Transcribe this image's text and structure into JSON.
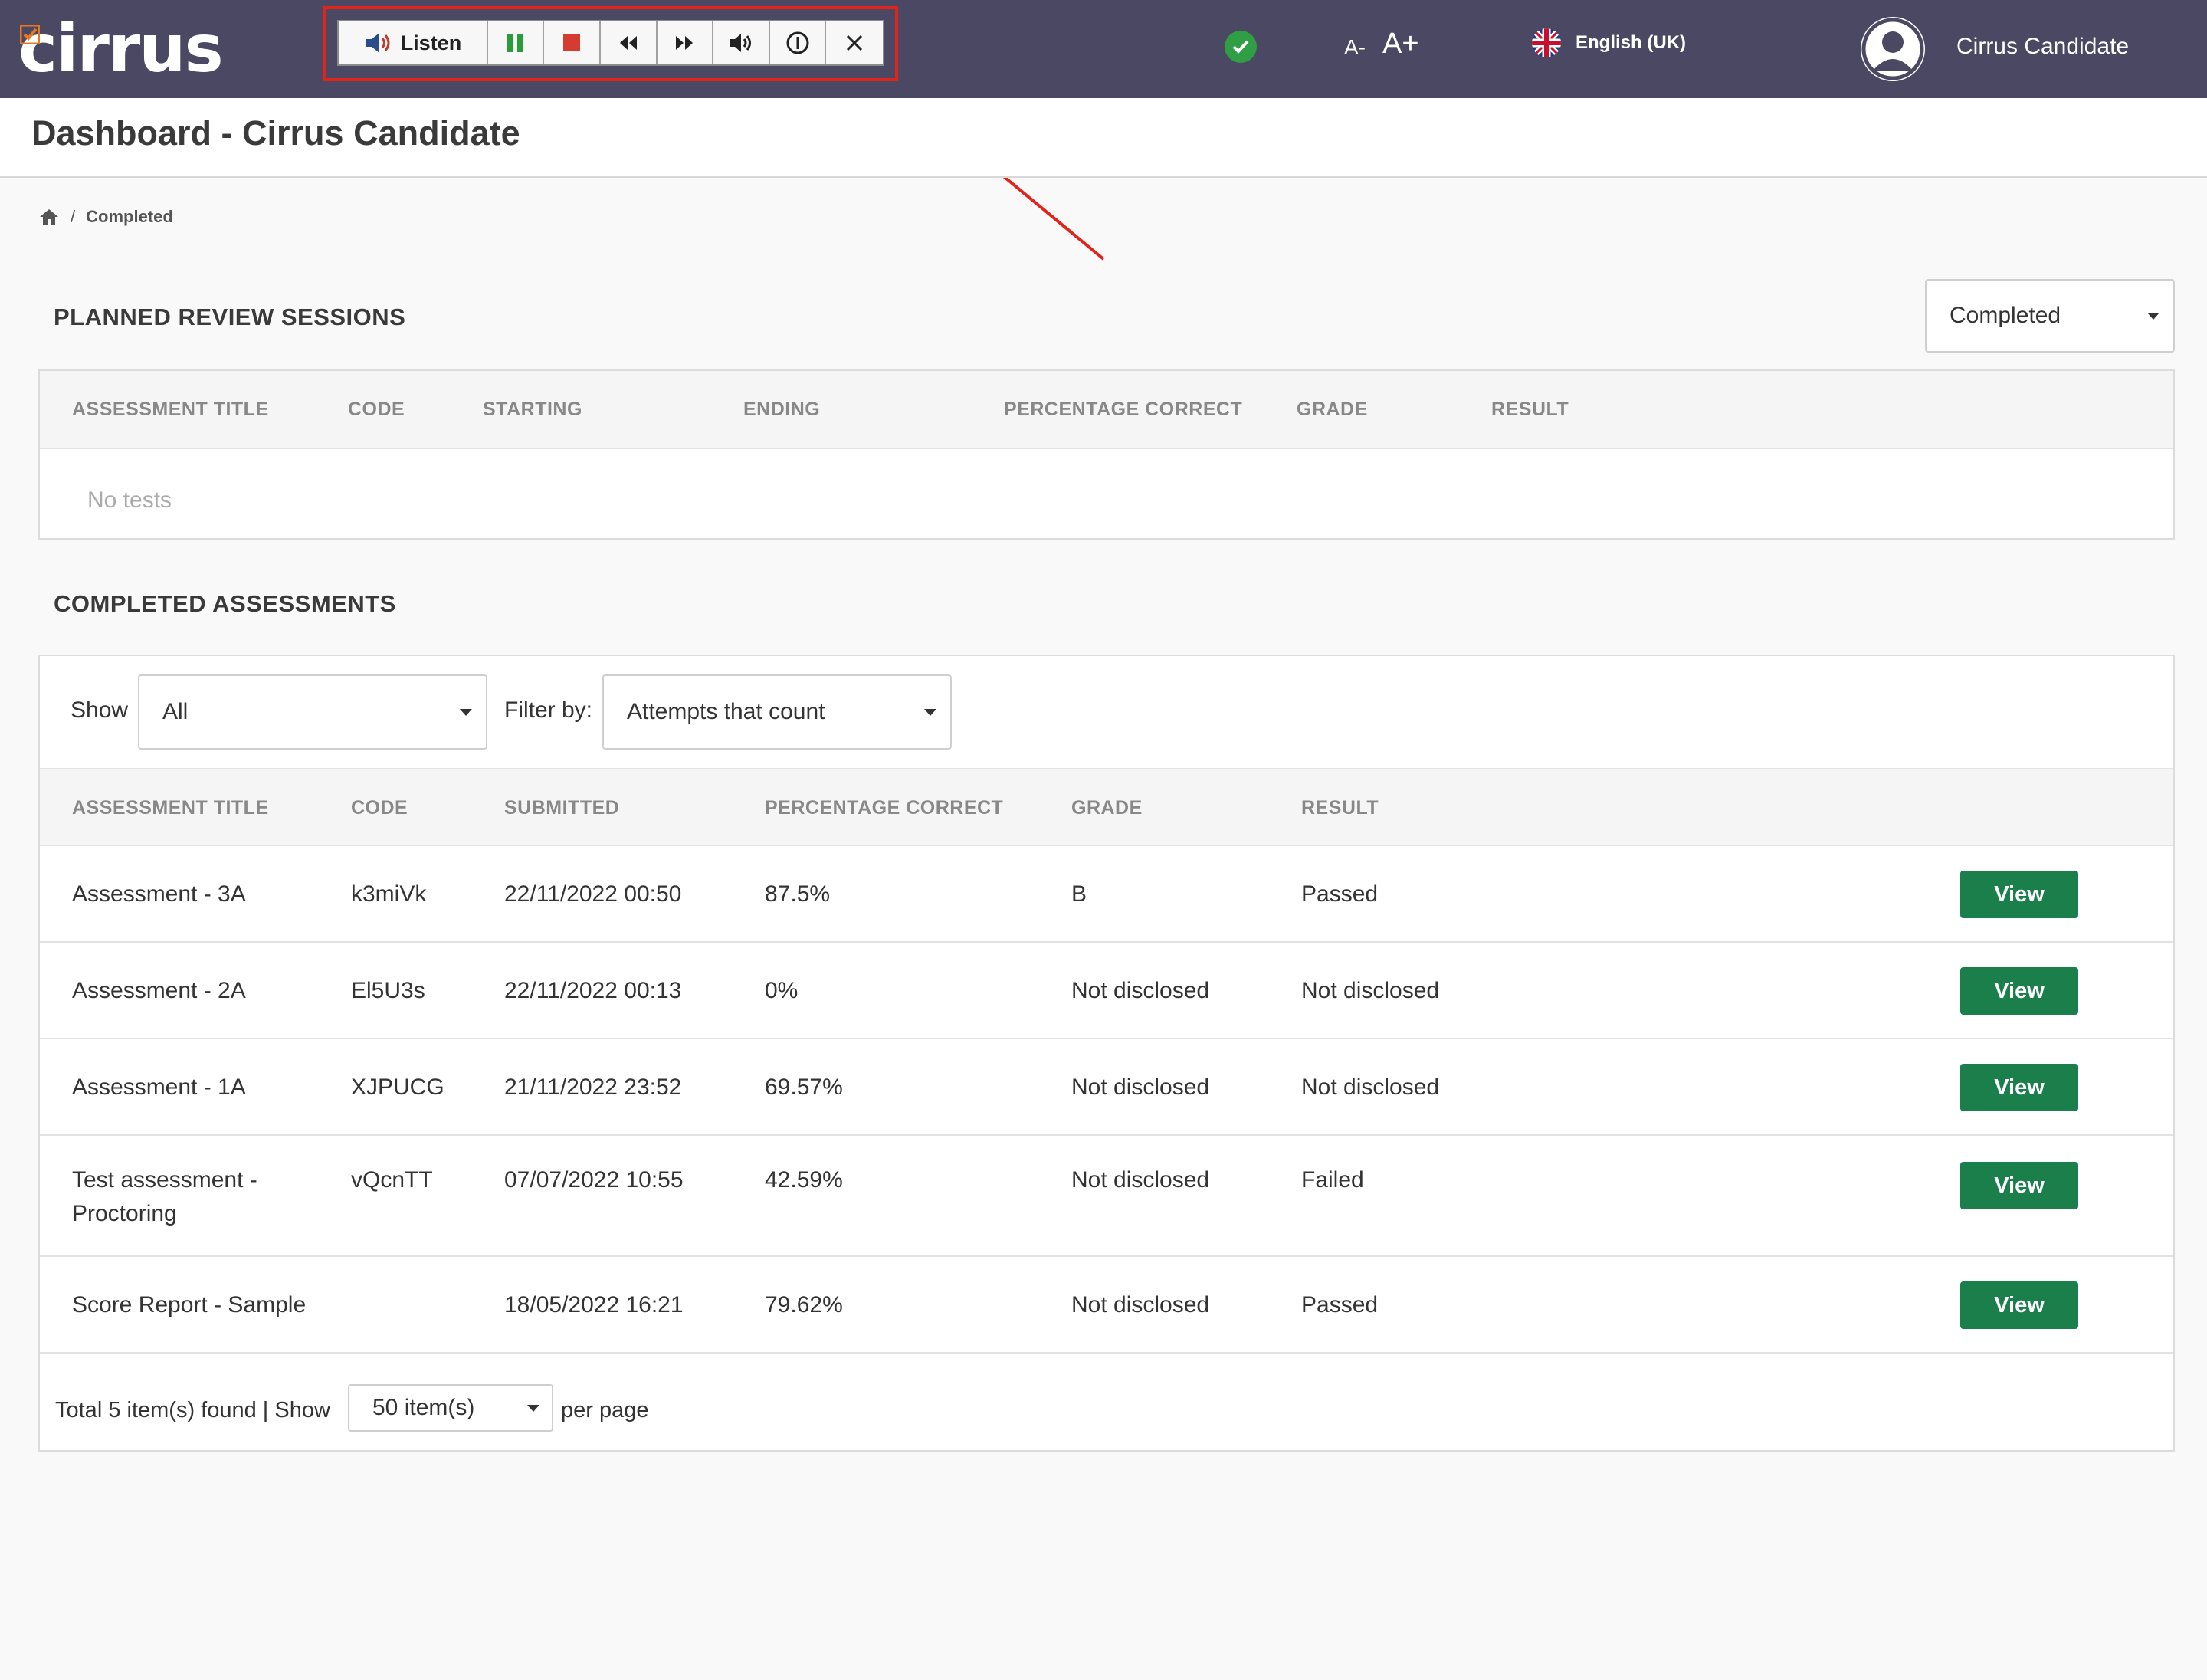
{
  "app": {
    "logo": "cirrus"
  },
  "readspeaker": {
    "listen_label": "Listen",
    "buttons": [
      "pause-icon",
      "stop-icon",
      "rewind-icon",
      "forward-icon",
      "volume-icon",
      "settings-icon",
      "close-icon"
    ]
  },
  "header": {
    "font_decrease": "A-",
    "font_increase": "A+",
    "language": "English (UK)",
    "user_name": "Cirrus Candidate"
  },
  "page": {
    "title": "Dashboard - Cirrus Candidate"
  },
  "breadcrumb": {
    "current": "Completed"
  },
  "planned": {
    "title": "PLANNED REVIEW SESSIONS",
    "status_filter": "Completed",
    "columns": [
      "ASSESSMENT TITLE",
      "CODE",
      "STARTING",
      "ENDING",
      "PERCENTAGE CORRECT",
      "GRADE",
      "RESULT"
    ],
    "empty_text": "No tests"
  },
  "completed": {
    "title": "COMPLETED ASSESSMENTS",
    "show_label": "Show",
    "show_value": "All",
    "filter_label": "Filter by:",
    "filter_value": "Attempts that count",
    "columns": [
      "ASSESSMENT TITLE",
      "CODE",
      "SUBMITTED",
      "PERCENTAGE CORRECT",
      "GRADE",
      "RESULT"
    ],
    "rows": [
      {
        "title": "Assessment - 3A",
        "code": "k3miVk",
        "submitted": "22/11/2022 00:50",
        "percent": "87.5%",
        "grade": "B",
        "result": "Passed",
        "action": "View"
      },
      {
        "title": "Assessment - 2A",
        "code": "El5U3s",
        "submitted": "22/11/2022 00:13",
        "percent": "0%",
        "grade": "Not disclosed",
        "result": "Not disclosed",
        "action": "View"
      },
      {
        "title": "Assessment - 1A",
        "code": "XJPUCG",
        "submitted": "21/11/2022 23:52",
        "percent": "69.57%",
        "grade": "Not disclosed",
        "result": "Not disclosed",
        "action": "View"
      },
      {
        "title": "Test assessment - Proctoring",
        "code": "vQcnTT",
        "submitted": "07/07/2022 10:55",
        "percent": "42.59%",
        "grade": "Not disclosed",
        "result": "Failed",
        "action": "View"
      },
      {
        "title": "Score Report - Sample",
        "code": "",
        "submitted": "18/05/2022 16:21",
        "percent": "79.62%",
        "grade": "Not disclosed",
        "result": "Passed",
        "action": "View"
      }
    ],
    "footer_total": "Total 5 item(s) found | Show",
    "per_page_value": "50 item(s)",
    "per_page_suffix": "per page"
  },
  "colors": {
    "topbar": "#4a4862",
    "view_button": "#1a7f4b",
    "highlight": "#e2231a",
    "logo_accent": "#e87722"
  }
}
